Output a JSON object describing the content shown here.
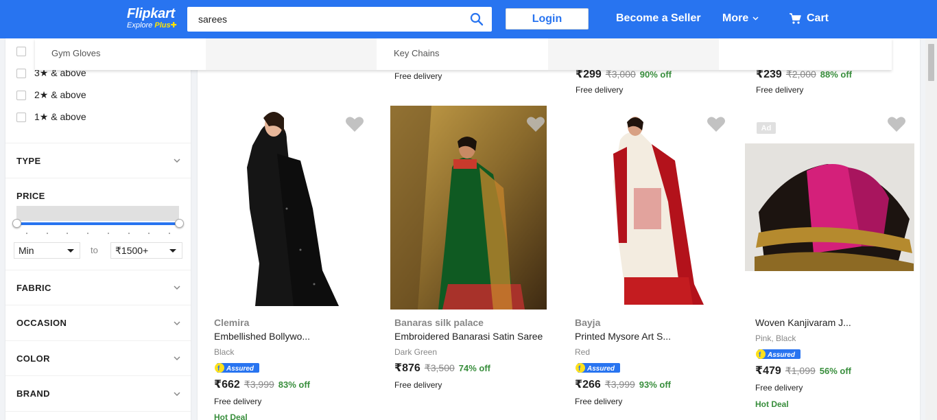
{
  "header": {
    "logo_name": "Flipkart",
    "logo_tag": "Explore",
    "logo_plus": "Plus",
    "search_value": "sarees",
    "login_label": "Login",
    "seller_label": "Become a Seller",
    "more_label": "More",
    "cart_label": "Cart",
    "brand_color": "#2874f0"
  },
  "dropdown": {
    "suggestions": [
      "Gym Gloves",
      "Key Chains"
    ]
  },
  "sidebar": {
    "ratings": [
      "3★ & above",
      "2★ & above",
      "1★ & above"
    ],
    "filters": [
      "TYPE",
      "FABRIC",
      "OCCASION",
      "COLOR",
      "BRAND"
    ],
    "price": {
      "label": "PRICE",
      "min": "Min",
      "to": "to",
      "max": "₹1500+"
    }
  },
  "top_row": [
    {
      "delivery": "Free delivery"
    },
    {
      "price": "₹299",
      "mrp": "₹3,000",
      "off": "90% off",
      "delivery": "Free delivery"
    },
    {
      "price": "₹239",
      "mrp": "₹2,000",
      "off": "88% off",
      "delivery": "Free delivery"
    }
  ],
  "products": [
    {
      "brand": "Clemira",
      "title": "Embellished Bollywo...",
      "color": "Black",
      "assured": "Assured",
      "price": "₹662",
      "mrp": "₹3,999",
      "off": "83% off",
      "delivery": "Free delivery",
      "deal": "Hot Deal"
    },
    {
      "brand": "Banaras silk palace",
      "title": "Embroidered Banarasi Satin Saree",
      "color": "Dark Green",
      "price": "₹876",
      "mrp": "₹3,500",
      "off": "74% off",
      "delivery": "Free delivery"
    },
    {
      "brand": "Bayja",
      "title": "Printed Mysore Art S...",
      "color": "Red",
      "assured": "Assured",
      "price": "₹266",
      "mrp": "₹3,999",
      "off": "93% off",
      "delivery": "Free delivery"
    },
    {
      "ad": "Ad",
      "title": "Woven Kanjivaram J...",
      "color": "Pink, Black",
      "assured": "Assured",
      "price": "₹479",
      "mrp": "₹1,099",
      "off": "56% off",
      "delivery": "Free delivery",
      "deal": "Hot Deal"
    }
  ]
}
